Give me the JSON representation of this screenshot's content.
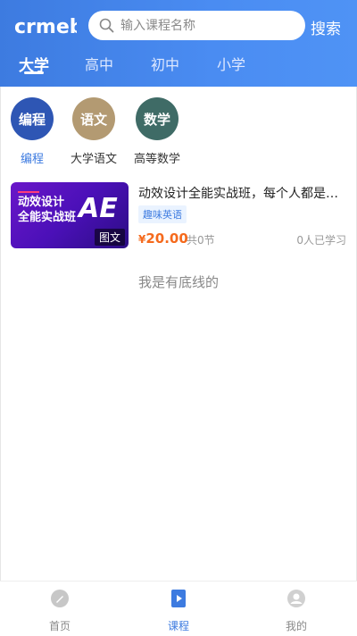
{
  "header": {
    "logo_text": "crmeb",
    "search_placeholder": "输入课程名称",
    "search_button": "搜索",
    "tabs": [
      {
        "label": "大学",
        "active": true
      },
      {
        "label": "高中",
        "active": false
      },
      {
        "label": "初中",
        "active": false
      },
      {
        "label": "小学",
        "active": false
      }
    ]
  },
  "categories": [
    {
      "circle_text": "编程",
      "label": "编程",
      "color": "#2e56b4",
      "active": true
    },
    {
      "circle_text": "语文",
      "label": "大学语文",
      "color": "#b39a72",
      "active": false
    },
    {
      "circle_text": "数学",
      "label": "高等数学",
      "color": "#3f6b66",
      "active": false
    }
  ],
  "course": {
    "title": "动效设计全能实战班，每个人都是…",
    "tag": "趣味英语",
    "price_symbol": "¥",
    "price": "20.00",
    "lessons": "共0节",
    "learners": "0人已学习",
    "thumb_line1": "动效设计",
    "thumb_line2": "全能实战班",
    "thumb_ae": "AE",
    "thumb_type": "图文"
  },
  "no_more_text": "我是有底线的",
  "tabbar": [
    {
      "label": "首页",
      "icon": "home-icon",
      "active": false
    },
    {
      "label": "课程",
      "icon": "course-icon",
      "active": true
    },
    {
      "label": "我的",
      "icon": "user-icon",
      "active": false
    }
  ],
  "colors": {
    "primary": "#3d7be0",
    "price": "#f56a1d"
  }
}
